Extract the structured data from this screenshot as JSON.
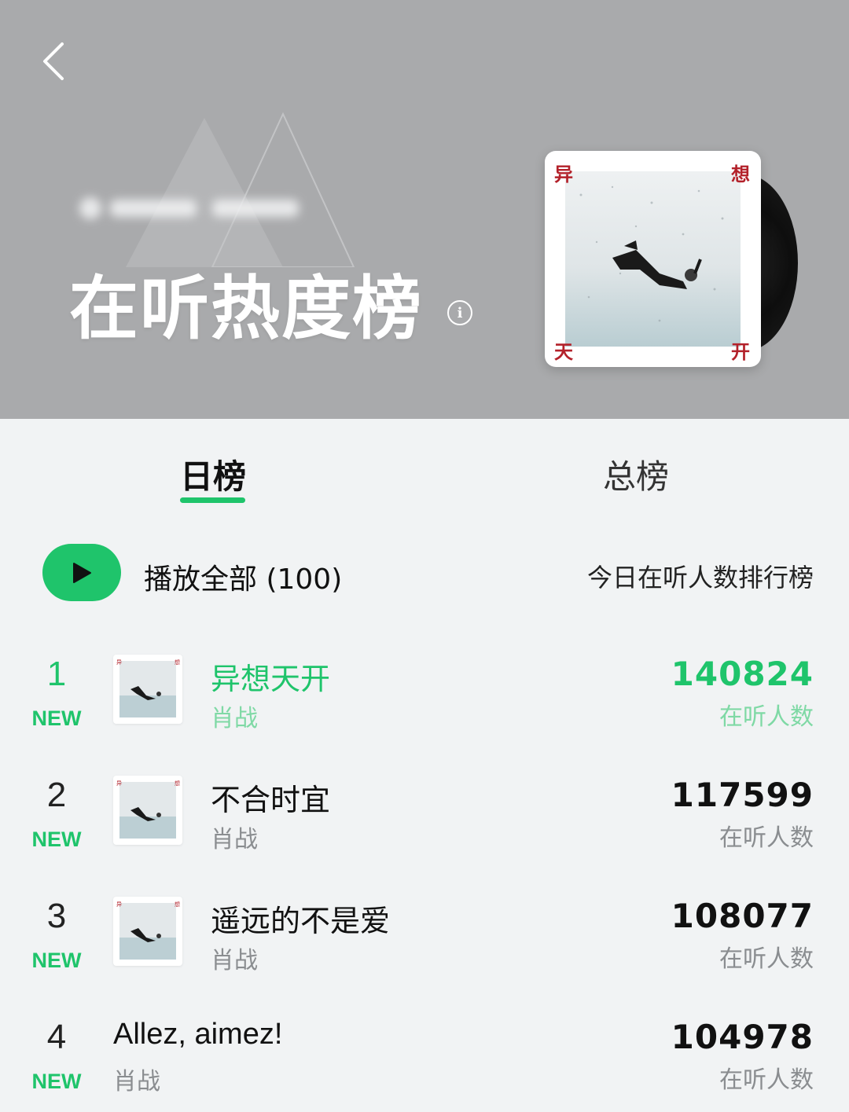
{
  "header": {
    "title": "在听热度榜",
    "info_icon": "info-icon",
    "back_icon": "chevron-left-icon",
    "cover_chars": [
      "异",
      "想",
      "天",
      "开"
    ]
  },
  "tabs": [
    {
      "label": "日榜",
      "selected": true
    },
    {
      "label": "总榜",
      "selected": false
    }
  ],
  "toolbar": {
    "play_all_label": "播放全部 (100)",
    "subtitle": "今日在听人数排行榜"
  },
  "songs": [
    {
      "rank": "1",
      "badge": "NEW",
      "title": "异想天开",
      "artist": "肖战",
      "count": "140824",
      "count_label": "在听人数",
      "active": true,
      "has_cover": true
    },
    {
      "rank": "2",
      "badge": "NEW",
      "title": "不合时宜",
      "artist": "肖战",
      "count": "117599",
      "count_label": "在听人数",
      "active": false,
      "has_cover": true
    },
    {
      "rank": "3",
      "badge": "NEW",
      "title": "遥远的不是爱",
      "artist": "肖战",
      "count": "108077",
      "count_label": "在听人数",
      "active": false,
      "has_cover": true
    },
    {
      "rank": "4",
      "badge": "NEW",
      "title": "Allez, aimez!",
      "artist": "肖战",
      "count": "104978",
      "count_label": "在听人数",
      "active": false,
      "has_cover": false
    }
  ],
  "colors": {
    "accent": "#1fc46b",
    "header_bg": "#a9aaac",
    "cover_text": "#b3212a"
  }
}
